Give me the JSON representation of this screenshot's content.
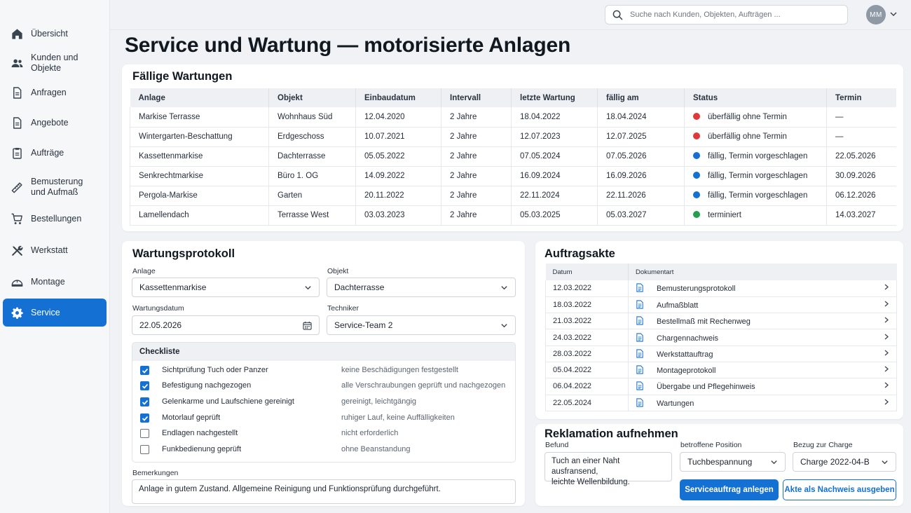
{
  "sidebar": {
    "items": [
      {
        "label": "Übersicht",
        "icon": "home-icon"
      },
      {
        "label": "Kunden und Objekte",
        "icon": "users-icon"
      },
      {
        "label": "Anfragen",
        "icon": "document-icon"
      },
      {
        "label": "Angebote",
        "icon": "document-icon"
      },
      {
        "label": "Aufträge",
        "icon": "clipboard-icon"
      },
      {
        "label": "Bemusterung\nund Aufmaß",
        "icon": "ruler-icon"
      },
      {
        "label": "Bestellungen",
        "icon": "cart-icon"
      },
      {
        "label": "Werkstatt",
        "icon": "tools-icon"
      },
      {
        "label": "Montage",
        "icon": "helmet-icon"
      },
      {
        "label": "Service",
        "icon": "gear-icon",
        "active": true
      }
    ]
  },
  "header": {
    "search_placeholder": "Suche nach Kunden, Objekten, Aufträgen ...",
    "avatar_initials": "MM"
  },
  "page": {
    "title": "Service und Wartung — motorisierte Anlagen"
  },
  "due": {
    "title": "Fällige Wartungen",
    "columns": [
      "Anlage",
      "Objekt",
      "Einbaudatum",
      "Intervall",
      "letzte Wartung",
      "fällig am",
      "Status",
      "Termin"
    ],
    "rows": [
      {
        "anlage": "Markise Terrasse",
        "objekt": "Wohnhaus Süd",
        "einbau": "12.04.2020",
        "intervall": "2 Jahre",
        "letzte": "18.04.2022",
        "faellig": "18.04.2024",
        "status": "überfällig ohne Termin",
        "status_color": "#e0393b",
        "termin": "—"
      },
      {
        "anlage": "Wintergarten-Beschattung",
        "objekt": "Erdgeschoss",
        "einbau": "10.07.2021",
        "intervall": "2 Jahre",
        "letzte": "12.07.2023",
        "faellig": "12.07.2025",
        "status": "überfällig ohne Termin",
        "status_color": "#e0393b",
        "termin": "—"
      },
      {
        "anlage": "Kassettenmarkise",
        "objekt": "Dachterrasse",
        "einbau": "05.05.2022",
        "intervall": "2 Jahre",
        "letzte": "07.05.2024",
        "faellig": "07.05.2026",
        "status": "fällig, Termin vorgeschlagen",
        "status_color": "#1470d2",
        "termin": "22.05.2026"
      },
      {
        "anlage": "Senkrechtmarkise",
        "objekt": "Büro 1. OG",
        "einbau": "14.09.2022",
        "intervall": "2 Jahre",
        "letzte": "16.09.2024",
        "faellig": "16.09.2026",
        "status": "fällig, Termin vorgeschlagen",
        "status_color": "#1470d2",
        "termin": "30.09.2026"
      },
      {
        "anlage": "Pergola-Markise",
        "objekt": "Garten",
        "einbau": "20.11.2022",
        "intervall": "2 Jahre",
        "letzte": "22.11.2024",
        "faellig": "22.11.2026",
        "status": "fällig, Termin vorgeschlagen",
        "status_color": "#1470d2",
        "termin": "06.12.2026"
      },
      {
        "anlage": "Lamellendach",
        "objekt": "Terrasse West",
        "einbau": "03.03.2023",
        "intervall": "2 Jahre",
        "letzte": "05.03.2025",
        "faellig": "05.03.2027",
        "status": "terminiert",
        "status_color": "#22a04b",
        "termin": "14.03.2027"
      }
    ]
  },
  "protocol": {
    "title": "Wartungsprotokoll",
    "anlage_label": "Anlage",
    "anlage_value": "Kassettenmarkise",
    "objekt_label": "Objekt",
    "objekt_value": "Dachterrasse",
    "datum_label": "Wartungsdatum",
    "datum_value": "22.05.2026",
    "techniker_label": "Techniker",
    "techniker_value": "Service-Team 2",
    "checklist_title": "Checkliste",
    "checklist": [
      {
        "item": "Sichtprüfung Tuch oder Panzer",
        "note": "keine Beschädigungen festgestellt",
        "checked": true
      },
      {
        "item": "Befestigung nachgezogen",
        "note": "alle Verschraubungen geprüft und nachgezogen",
        "checked": true
      },
      {
        "item": "Gelenkarme und Laufschiene gereinigt",
        "note": "gereinigt, leichtgängig",
        "checked": true
      },
      {
        "item": "Motorlauf geprüft",
        "note": "ruhiger Lauf, keine Auffälligkeiten",
        "checked": true
      },
      {
        "item": "Endlagen nachgestellt",
        "note": "nicht erforderlich",
        "checked": false
      },
      {
        "item": "Funkbedienung geprüft",
        "note": "ohne Beanstandung",
        "checked": false
      }
    ],
    "remarks_label": "Bemerkungen",
    "remarks_value": "Anlage in gutem Zustand. Allgemeine Reinigung und Funktionsprüfung durchgeführt."
  },
  "file": {
    "title": "Auftragsakte",
    "columns": [
      "Datum",
      "Dokumentart"
    ],
    "rows": [
      {
        "datum": "12.03.2022",
        "doc": "Bemusterungsprotokoll"
      },
      {
        "datum": "18.03.2022",
        "doc": "Aufmaßblatt"
      },
      {
        "datum": "21.03.2022",
        "doc": "Bestellmaß mit Rechenweg"
      },
      {
        "datum": "24.03.2022",
        "doc": "Chargennachweis"
      },
      {
        "datum": "28.03.2022",
        "doc": "Werkstattauftrag"
      },
      {
        "datum": "05.04.2022",
        "doc": "Montageprotokoll"
      },
      {
        "datum": "06.04.2022",
        "doc": "Übergabe und Pflegehinweis"
      },
      {
        "datum": "22.05.2024",
        "doc": "Wartungen"
      }
    ]
  },
  "complaint": {
    "title": "Reklamation aufnehmen",
    "befund_label": "Befund",
    "befund_value": "Tuch an einer Naht ausfransend,\nleichte Wellenbildung.",
    "position_label": "betroffene Position",
    "position_value": "Tuchbespannung",
    "charge_label": "Bezug zur Charge",
    "charge_value": "Charge 2022-04-B",
    "primary_button": "Serviceauftrag anlegen",
    "secondary_button": "Akte als Nachweis ausgeben"
  },
  "colors": {
    "accent": "#1470d2",
    "overdue": "#e0393b",
    "scheduled": "#22a04b"
  }
}
